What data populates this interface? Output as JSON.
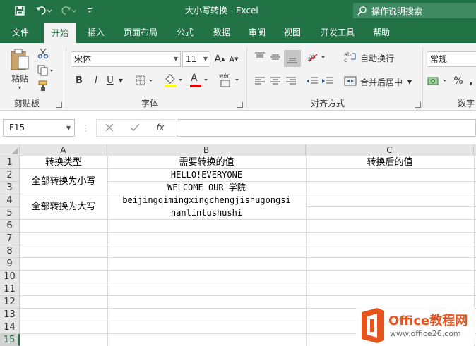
{
  "window": {
    "title": "大小写转换  -  Excel",
    "tell_me": "操作说明搜索"
  },
  "tabs": [
    "文件",
    "开始",
    "插入",
    "页面布局",
    "公式",
    "数据",
    "审阅",
    "视图",
    "开发工具",
    "帮助"
  ],
  "active_tab": "开始",
  "ribbon": {
    "clipboard": {
      "paste": "粘贴",
      "label": "剪贴板"
    },
    "font": {
      "name": "宋体",
      "size": "11",
      "label": "字体",
      "grow": "A",
      "shrink": "A",
      "bold": "B",
      "italic": "I",
      "underline": "U",
      "font_color_glyph": "A",
      "phonetic_glyph": "wén"
    },
    "alignment": {
      "wrap_text": "自动换行",
      "merge_center": "合并后居中",
      "label": "对齐方式"
    },
    "number": {
      "format": "常规",
      "percent": "%",
      "label": "数字"
    }
  },
  "formula_bar": {
    "name_box": "F15",
    "fx": "fx",
    "content": ""
  },
  "columns": [
    "A",
    "B",
    "C"
  ],
  "rows": [
    "1",
    "2",
    "3",
    "4",
    "5",
    "6",
    "7",
    "8",
    "9",
    "10",
    "11",
    "12",
    "13",
    "14",
    "15"
  ],
  "selected_row": "15",
  "cells": {
    "A1": "转换类型",
    "B1": "需要转换的值",
    "C1": "转换后的值",
    "A2": "全部转换为小写",
    "B2": "HELLO!EVERYONE",
    "B3": "WELCOME OUR 学院",
    "A4": "全部转换为大写",
    "B4": "beijingqimingxingchengjishugongsi",
    "B5": "hanlintushushi"
  },
  "watermark": {
    "brand": "Office教程网",
    "url": "www.office26.com"
  },
  "colors": {
    "excel_green": "#217346",
    "ribbon_bg": "#f3f3f3",
    "watermark_orange": "#e8541e"
  }
}
